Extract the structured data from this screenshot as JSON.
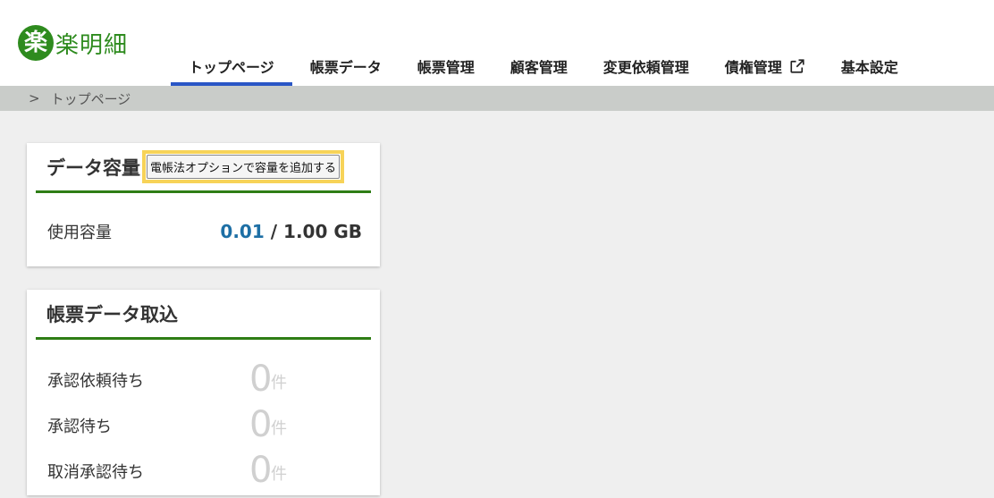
{
  "logo": {
    "mark": "楽",
    "text": "楽明細"
  },
  "nav": {
    "items": [
      {
        "label": "トップページ"
      },
      {
        "label": "帳票データ"
      },
      {
        "label": "帳票管理"
      },
      {
        "label": "顧客管理"
      },
      {
        "label": "変更依頼管理"
      },
      {
        "label": "債権管理"
      },
      {
        "label": "基本設定"
      }
    ]
  },
  "breadcrumb": {
    "separator": ">",
    "current": "トップページ"
  },
  "storage": {
    "title": "データ容量",
    "option_button": "電帳法オプションで容量を追加する",
    "usage_label": "使用容量",
    "used": "0.01",
    "divider": "/",
    "total": "1.00 GB"
  },
  "import": {
    "title": "帳票データ取込",
    "rows": [
      {
        "label": "承認依頼待ち",
        "count": "0",
        "unit": "件"
      },
      {
        "label": "承認待ち",
        "count": "0",
        "unit": "件"
      },
      {
        "label": "取消承認待ち",
        "count": "0",
        "unit": "件"
      }
    ]
  },
  "colors": {
    "brand_green": "#2e8b1e",
    "active_tab": "#2a56c6",
    "highlight": "#f7d358",
    "usage_blue": "#1d6fa5"
  }
}
